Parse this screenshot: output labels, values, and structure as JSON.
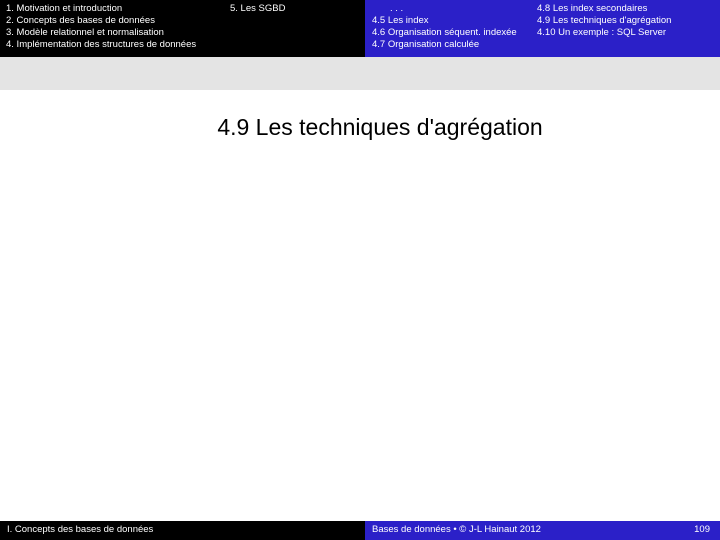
{
  "header": {
    "left_items": [
      "1. Motivation et introduction",
      "2. Concepts des bases de données",
      "3. Modèle relationnel et normalisation",
      "4. Implémentation des structures de données"
    ],
    "chapter5": "5. Les SGBD",
    "right_col1": [
      ". . .",
      "4.5 Les index",
      "4.6 Organisation séquent. indexée",
      "4.7 Organisation calculée"
    ],
    "right_col2": [
      "4.8 Les index secondaires",
      "4.9 Les techniques d'agrégation",
      "4.10 Un exemple : SQL Server"
    ]
  },
  "slide": {
    "title": "4.9  Les techniques d'agrégation"
  },
  "footer": {
    "left": "I. Concepts des bases de données",
    "center": "Bases de données • © J-L Hainaut 2012",
    "page": "109"
  },
  "colors": {
    "header_left_bg": "#000000",
    "header_right_bg": "#2b20c8",
    "band_bg": "#e4e4e4"
  }
}
